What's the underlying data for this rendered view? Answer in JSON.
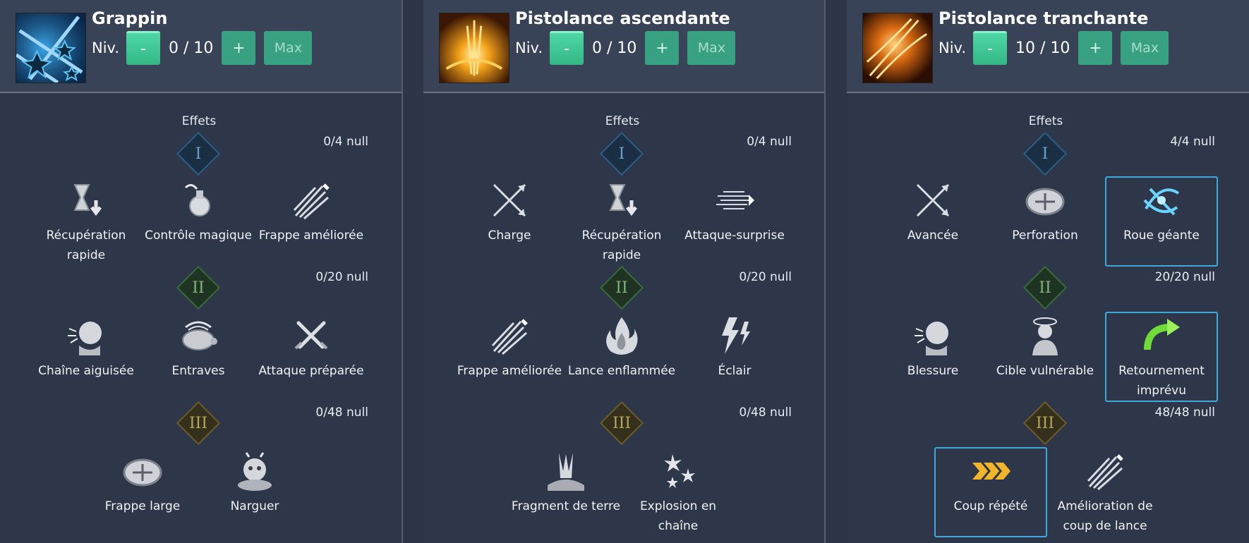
{
  "panels": [
    {
      "title": "Grappin",
      "level_label": "Niv.",
      "level_value": "0 / 10",
      "minus_label": "-",
      "plus_label": "+",
      "max_label": "Max",
      "effects_label": "Effets",
      "tiers": [
        {
          "numeral": "I",
          "count": "0/4 null",
          "effects": [
            "Récupération rapide",
            "Contrôle magique",
            "Frappe améliorée"
          ]
        },
        {
          "numeral": "II",
          "count": "0/20 null",
          "effects": [
            "Chaîne aiguisée",
            "Entraves",
            "Attaque préparée"
          ]
        },
        {
          "numeral": "III",
          "count": "0/48 null",
          "effects": [
            "Frappe large",
            "Narguer"
          ]
        }
      ]
    },
    {
      "title": "Pistolance ascendante",
      "level_label": "Niv.",
      "level_value": "0 / 10",
      "minus_label": "-",
      "plus_label": "+",
      "max_label": "Max",
      "effects_label": "Effets",
      "tiers": [
        {
          "numeral": "I",
          "count": "0/4 null",
          "effects": [
            "Charge",
            "Récupération rapide",
            "Attaque-surprise"
          ]
        },
        {
          "numeral": "II",
          "count": "0/20 null",
          "effects": [
            "Frappe améliorée",
            "Lance enflammée",
            "Éclair"
          ]
        },
        {
          "numeral": "III",
          "count": "0/48 null",
          "effects": [
            "Fragment de terre",
            "Explosion en chaîne"
          ]
        }
      ]
    },
    {
      "title": "Pistolance tranchante",
      "level_label": "Niv.",
      "level_value": "10 / 10",
      "minus_label": "-",
      "plus_label": "+",
      "max_label": "Max",
      "effects_label": "Effets",
      "tiers": [
        {
          "numeral": "I",
          "count": "4/4 null",
          "effects": [
            "Avancée",
            "Perforation",
            "Roue géante"
          ],
          "selected": 2
        },
        {
          "numeral": "II",
          "count": "20/20 null",
          "effects": [
            "Blessure",
            "Cible vulnérable",
            "Retournement imprévu"
          ],
          "selected": 2
        },
        {
          "numeral": "III",
          "count": "48/48 null",
          "effects": [
            "Coup répété",
            "Amélioration de coup de lance"
          ],
          "selected": 0
        }
      ]
    }
  ],
  "colors": {
    "background": "#2e3649",
    "header": "#394358",
    "button_green": "#38a182",
    "selection_border": "#3fa9db"
  }
}
